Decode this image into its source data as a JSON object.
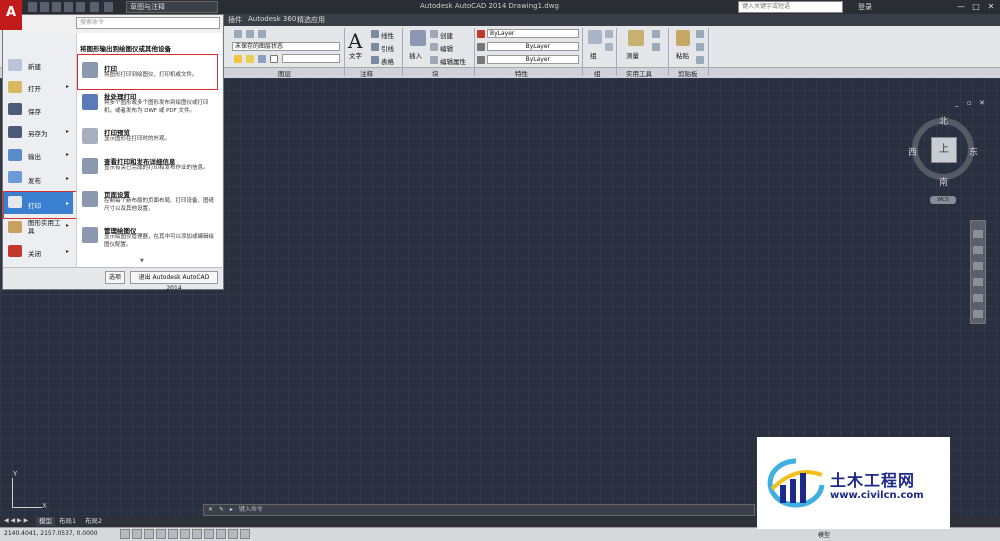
{
  "titlebar": {
    "workspace": "草图与注释",
    "title": "Autodesk AutoCAD 2014    Drawing1.dwg",
    "search_placeholder": "键入关键字或短语",
    "login": "登录",
    "min": "—",
    "max": "□",
    "close": "✕"
  },
  "ribbon_tabs": [
    "插件",
    "Autodesk 360",
    "精选应用"
  ],
  "ribbon": {
    "layer_state": "未保存的图层状态",
    "text": "文字",
    "dim_linear": "线性",
    "dim_leader": "引线",
    "dim_table": "表格",
    "block_insert": "插入",
    "block_create": "创建",
    "block_edit": "编辑",
    "block_attr": "编辑属性",
    "bylayer1": "ByLayer",
    "bylayer2": "ByLayer",
    "bylayer3": "ByLayer",
    "group": "组",
    "measure": "测量",
    "paste": "粘贴",
    "panels": {
      "layer": "图层",
      "annotation": "注释",
      "block": "块",
      "properties": "特性",
      "groups": "组",
      "utilities": "实用工具",
      "clipboard": "剪贴板"
    }
  },
  "app_menu": {
    "search_placeholder": "搜索命令",
    "left_items": [
      {
        "label": "新建"
      },
      {
        "label": "打开"
      },
      {
        "label": "保存"
      },
      {
        "label": "另存为"
      },
      {
        "label": "输出"
      },
      {
        "label": "发布"
      },
      {
        "label": "打印"
      },
      {
        "label": "图形实用工具"
      },
      {
        "label": "关闭"
      }
    ],
    "right_header": "将图形输出到绘图仪或其他设备",
    "right_items": [
      {
        "title": "打印",
        "desc": "将图形打印到绘图仪、打印机或文件。"
      },
      {
        "title": "批处理打印",
        "desc": "将多个图形或多个图形发布到绘图仪或打印机，或者发布为 DWF 或 PDF 文件。"
      },
      {
        "title": "打印预览",
        "desc": "显示图形在打印时的外观。"
      },
      {
        "title": "查看打印和发布详细信息",
        "desc": "显示有关已完成的打印和发布作业的信息。"
      },
      {
        "title": "页面设置",
        "desc": "控制每个新布局的页面布局、打印设备、图纸尺寸以及其他设置。"
      },
      {
        "title": "管理绘图仪",
        "desc": "显示绘图仪管理器，在其中可以添加或编辑绘图仪配置。"
      }
    ],
    "options_button": "选项",
    "exit_button": "退出 Autodesk AutoCAD 2014"
  },
  "viewcube": {
    "north": "北",
    "south": "南",
    "east": "东",
    "west": "西",
    "top": "上",
    "wcs": "WCS"
  },
  "command_line": {
    "placeholder": "键入命令"
  },
  "layout_tabs": [
    "模型",
    "布局1",
    "布局2"
  ],
  "status": {
    "coords": "2140.4041, 2157.0537, 0.0000",
    "model": "模型"
  },
  "ucs": {
    "x": "X",
    "y": "Y"
  },
  "watermark": {
    "title": "土木工程网",
    "url": "www.civilcn.com"
  }
}
